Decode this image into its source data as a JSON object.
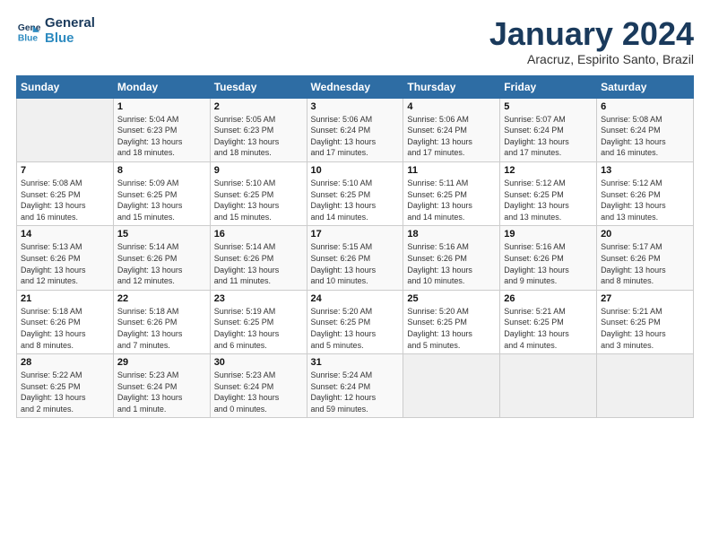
{
  "logo": {
    "line1": "General",
    "line2": "Blue"
  },
  "title": "January 2024",
  "subtitle": "Aracruz, Espirito Santo, Brazil",
  "days_of_week": [
    "Sunday",
    "Monday",
    "Tuesday",
    "Wednesday",
    "Thursday",
    "Friday",
    "Saturday"
  ],
  "weeks": [
    [
      {
        "num": "",
        "lines": []
      },
      {
        "num": "1",
        "lines": [
          "Sunrise: 5:04 AM",
          "Sunset: 6:23 PM",
          "Daylight: 13 hours",
          "and 18 minutes."
        ]
      },
      {
        "num": "2",
        "lines": [
          "Sunrise: 5:05 AM",
          "Sunset: 6:23 PM",
          "Daylight: 13 hours",
          "and 18 minutes."
        ]
      },
      {
        "num": "3",
        "lines": [
          "Sunrise: 5:06 AM",
          "Sunset: 6:24 PM",
          "Daylight: 13 hours",
          "and 17 minutes."
        ]
      },
      {
        "num": "4",
        "lines": [
          "Sunrise: 5:06 AM",
          "Sunset: 6:24 PM",
          "Daylight: 13 hours",
          "and 17 minutes."
        ]
      },
      {
        "num": "5",
        "lines": [
          "Sunrise: 5:07 AM",
          "Sunset: 6:24 PM",
          "Daylight: 13 hours",
          "and 17 minutes."
        ]
      },
      {
        "num": "6",
        "lines": [
          "Sunrise: 5:08 AM",
          "Sunset: 6:24 PM",
          "Daylight: 13 hours",
          "and 16 minutes."
        ]
      }
    ],
    [
      {
        "num": "7",
        "lines": [
          "Sunrise: 5:08 AM",
          "Sunset: 6:25 PM",
          "Daylight: 13 hours",
          "and 16 minutes."
        ]
      },
      {
        "num": "8",
        "lines": [
          "Sunrise: 5:09 AM",
          "Sunset: 6:25 PM",
          "Daylight: 13 hours",
          "and 15 minutes."
        ]
      },
      {
        "num": "9",
        "lines": [
          "Sunrise: 5:10 AM",
          "Sunset: 6:25 PM",
          "Daylight: 13 hours",
          "and 15 minutes."
        ]
      },
      {
        "num": "10",
        "lines": [
          "Sunrise: 5:10 AM",
          "Sunset: 6:25 PM",
          "Daylight: 13 hours",
          "and 14 minutes."
        ]
      },
      {
        "num": "11",
        "lines": [
          "Sunrise: 5:11 AM",
          "Sunset: 6:25 PM",
          "Daylight: 13 hours",
          "and 14 minutes."
        ]
      },
      {
        "num": "12",
        "lines": [
          "Sunrise: 5:12 AM",
          "Sunset: 6:25 PM",
          "Daylight: 13 hours",
          "and 13 minutes."
        ]
      },
      {
        "num": "13",
        "lines": [
          "Sunrise: 5:12 AM",
          "Sunset: 6:26 PM",
          "Daylight: 13 hours",
          "and 13 minutes."
        ]
      }
    ],
    [
      {
        "num": "14",
        "lines": [
          "Sunrise: 5:13 AM",
          "Sunset: 6:26 PM",
          "Daylight: 13 hours",
          "and 12 minutes."
        ]
      },
      {
        "num": "15",
        "lines": [
          "Sunrise: 5:14 AM",
          "Sunset: 6:26 PM",
          "Daylight: 13 hours",
          "and 12 minutes."
        ]
      },
      {
        "num": "16",
        "lines": [
          "Sunrise: 5:14 AM",
          "Sunset: 6:26 PM",
          "Daylight: 13 hours",
          "and 11 minutes."
        ]
      },
      {
        "num": "17",
        "lines": [
          "Sunrise: 5:15 AM",
          "Sunset: 6:26 PM",
          "Daylight: 13 hours",
          "and 10 minutes."
        ]
      },
      {
        "num": "18",
        "lines": [
          "Sunrise: 5:16 AM",
          "Sunset: 6:26 PM",
          "Daylight: 13 hours",
          "and 10 minutes."
        ]
      },
      {
        "num": "19",
        "lines": [
          "Sunrise: 5:16 AM",
          "Sunset: 6:26 PM",
          "Daylight: 13 hours",
          "and 9 minutes."
        ]
      },
      {
        "num": "20",
        "lines": [
          "Sunrise: 5:17 AM",
          "Sunset: 6:26 PM",
          "Daylight: 13 hours",
          "and 8 minutes."
        ]
      }
    ],
    [
      {
        "num": "21",
        "lines": [
          "Sunrise: 5:18 AM",
          "Sunset: 6:26 PM",
          "Daylight: 13 hours",
          "and 8 minutes."
        ]
      },
      {
        "num": "22",
        "lines": [
          "Sunrise: 5:18 AM",
          "Sunset: 6:26 PM",
          "Daylight: 13 hours",
          "and 7 minutes."
        ]
      },
      {
        "num": "23",
        "lines": [
          "Sunrise: 5:19 AM",
          "Sunset: 6:25 PM",
          "Daylight: 13 hours",
          "and 6 minutes."
        ]
      },
      {
        "num": "24",
        "lines": [
          "Sunrise: 5:20 AM",
          "Sunset: 6:25 PM",
          "Daylight: 13 hours",
          "and 5 minutes."
        ]
      },
      {
        "num": "25",
        "lines": [
          "Sunrise: 5:20 AM",
          "Sunset: 6:25 PM",
          "Daylight: 13 hours",
          "and 5 minutes."
        ]
      },
      {
        "num": "26",
        "lines": [
          "Sunrise: 5:21 AM",
          "Sunset: 6:25 PM",
          "Daylight: 13 hours",
          "and 4 minutes."
        ]
      },
      {
        "num": "27",
        "lines": [
          "Sunrise: 5:21 AM",
          "Sunset: 6:25 PM",
          "Daylight: 13 hours",
          "and 3 minutes."
        ]
      }
    ],
    [
      {
        "num": "28",
        "lines": [
          "Sunrise: 5:22 AM",
          "Sunset: 6:25 PM",
          "Daylight: 13 hours",
          "and 2 minutes."
        ]
      },
      {
        "num": "29",
        "lines": [
          "Sunrise: 5:23 AM",
          "Sunset: 6:24 PM",
          "Daylight: 13 hours",
          "and 1 minute."
        ]
      },
      {
        "num": "30",
        "lines": [
          "Sunrise: 5:23 AM",
          "Sunset: 6:24 PM",
          "Daylight: 13 hours",
          "and 0 minutes."
        ]
      },
      {
        "num": "31",
        "lines": [
          "Sunrise: 5:24 AM",
          "Sunset: 6:24 PM",
          "Daylight: 12 hours",
          "and 59 minutes."
        ]
      },
      {
        "num": "",
        "lines": []
      },
      {
        "num": "",
        "lines": []
      },
      {
        "num": "",
        "lines": []
      }
    ]
  ]
}
